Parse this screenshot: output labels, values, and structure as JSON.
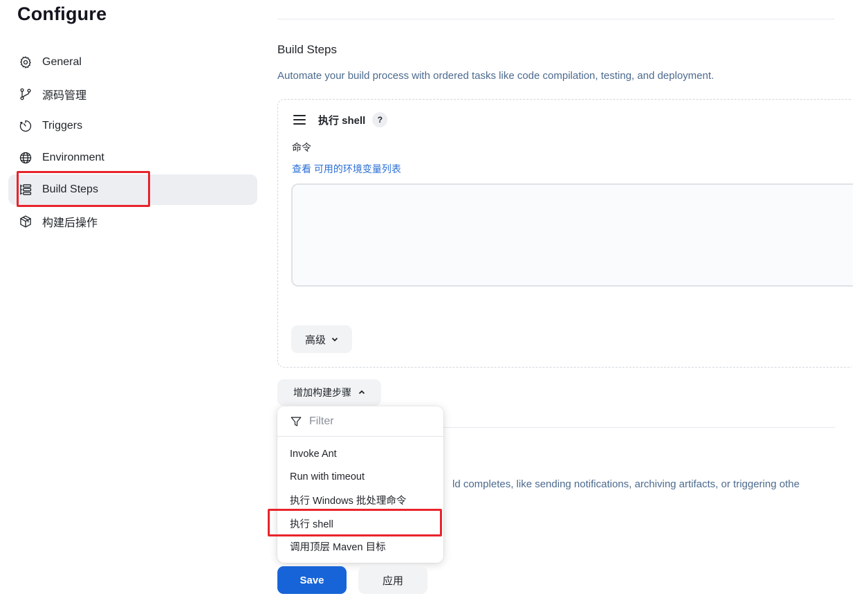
{
  "page": {
    "title": "Configure"
  },
  "sidebar": {
    "items": [
      {
        "label": "General",
        "icon": "gear-icon"
      },
      {
        "label": "源码管理",
        "icon": "git-branch-icon"
      },
      {
        "label": "Triggers",
        "icon": "timer-icon"
      },
      {
        "label": "Environment",
        "icon": "globe-icon"
      },
      {
        "label": "Build Steps",
        "icon": "list-steps-icon",
        "active": true
      },
      {
        "label": "构建后操作",
        "icon": "package-icon"
      }
    ]
  },
  "build_steps": {
    "title": "Build Steps",
    "description": "Automate your build process with ordered tasks like code compilation, testing, and deployment.",
    "step": {
      "name": "执行 shell",
      "help": "?",
      "command_label": "命令",
      "env_link_prefix": "查看 ",
      "env_link_text": "可用的环境变量列表",
      "command_value": "",
      "advanced_label": "高级"
    },
    "add_step_label": "增加构建步骤"
  },
  "dropdown": {
    "filter_placeholder": "Filter",
    "items": [
      "Invoke Ant",
      "Run with timeout",
      "执行 Windows 批处理命令",
      "执行 shell",
      "调用顶层 Maven 目标"
    ]
  },
  "post_build": {
    "description_visible": "ld completes, like sending notifications, archiving artifacts, or triggering othe"
  },
  "actions": {
    "save_label": "Save",
    "apply_label": "应用"
  },
  "colors": {
    "primary": "#1764d8",
    "link": "#2b6fd6",
    "highlight": "#e8242c",
    "active_bg": "#eceef2"
  }
}
